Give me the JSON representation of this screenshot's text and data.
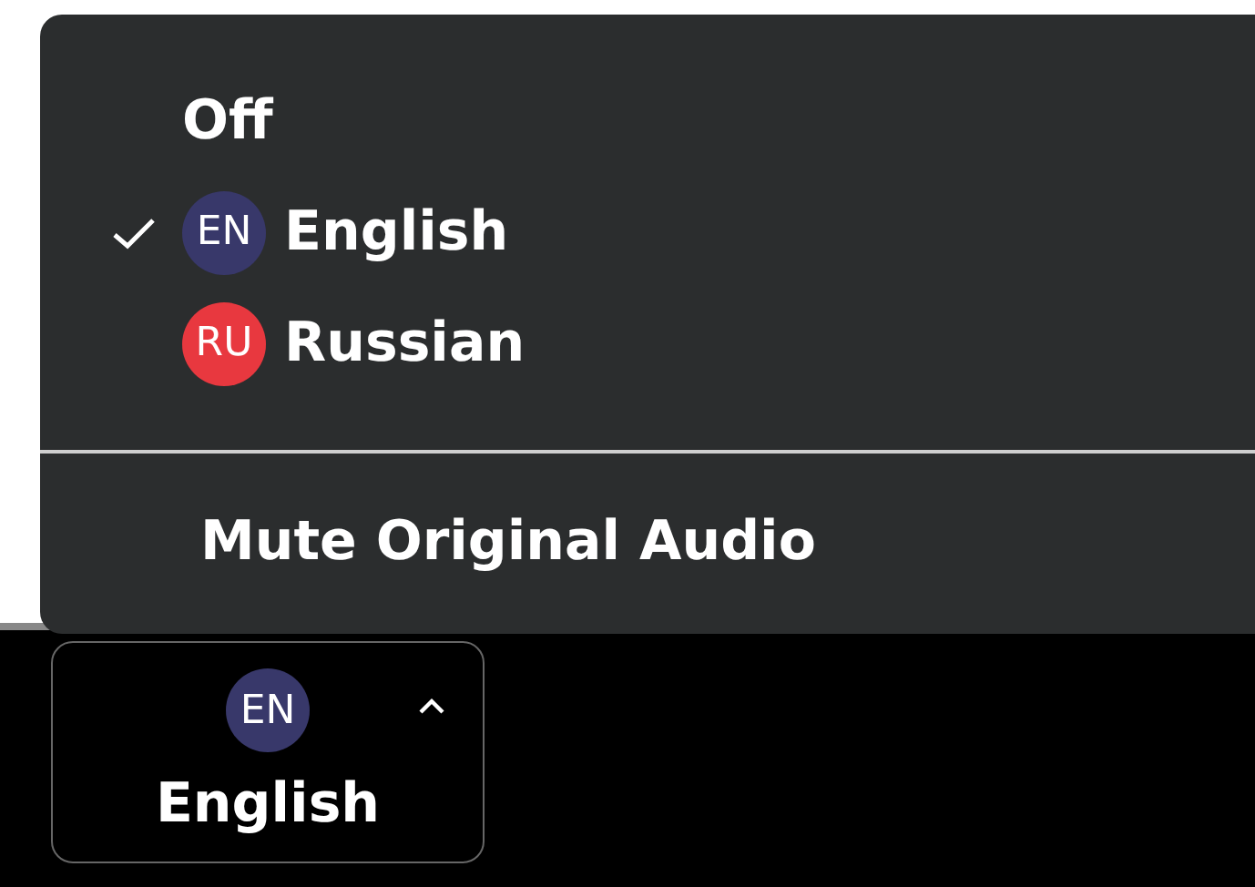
{
  "menu": {
    "items": [
      {
        "kind": "plain",
        "label": "Off",
        "checked": false
      },
      {
        "kind": "language",
        "badge": "EN",
        "color": "#38386a",
        "label": "English",
        "checked": true
      },
      {
        "kind": "language",
        "badge": "RU",
        "color": "#e8383f",
        "label": "Russian",
        "checked": false
      }
    ],
    "footer_items": [
      {
        "label": "Mute Original Audio"
      }
    ]
  },
  "button": {
    "badge": "EN",
    "color": "#38386a",
    "label": "English"
  }
}
